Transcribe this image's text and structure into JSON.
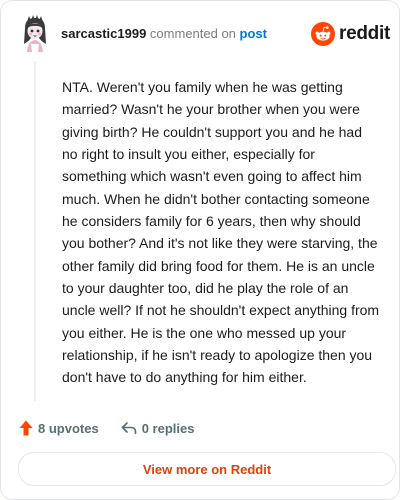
{
  "header": {
    "username": "sarcastic1999",
    "meta_text": " commented on ",
    "post_link": "post"
  },
  "brand": {
    "wordmark": "reddit",
    "color": "#ff4500"
  },
  "comment": {
    "body": "NTA. Weren't you family when he was getting married? Wasn't he your brother when you were giving birth? He couldn't support you and he had no right to insult you either, especially for something which wasn't even going to affect him much. When he didn't bother contacting someone he considers family for 6 years, then why should you bother? And it's not like they were starving, the other family did bring food for them. He is an uncle to your daughter too, did he play the role of an uncle well? If not he shouldn't expect anything from you either. He is the one who messed up your relationship, if he isn't ready to apologize then you don't have to do anything for him either."
  },
  "actions": {
    "upvotes": "8 upvotes",
    "replies": "0 replies",
    "upvote_icon": "upvote-arrow-icon",
    "reply_icon": "reply-arrow-icon"
  },
  "footer": {
    "view_more": "View more on Reddit",
    "color": "#e0410c"
  },
  "colors": {
    "text": "#1c1c1c",
    "muted": "#7c7c7c",
    "link": "#0079d3",
    "upvote": "#ff4500"
  }
}
